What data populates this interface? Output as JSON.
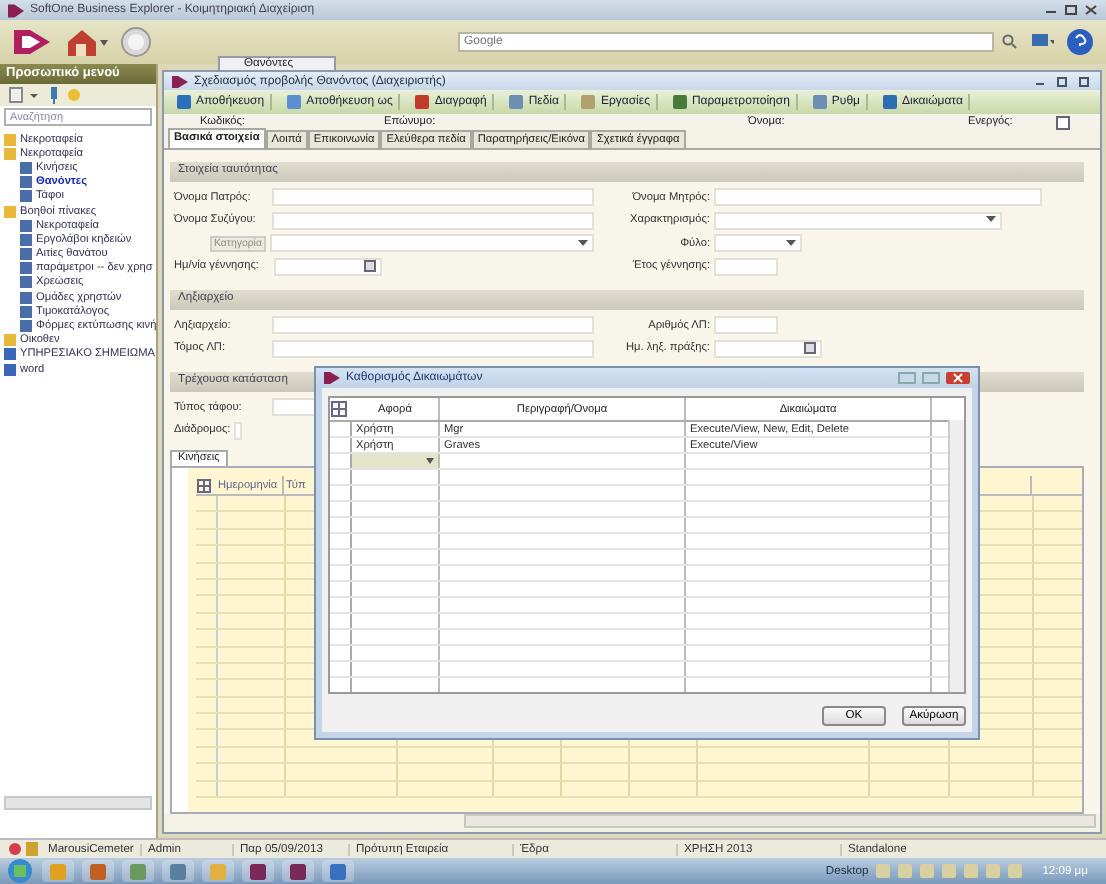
{
  "window": {
    "title": "SoftOne Business Explorer - Κοιμητηριακή Διαχείριση"
  },
  "toolbar": {
    "search": {
      "placeholder": "Google"
    }
  },
  "sidebar": {
    "title": "Προσωπικό μενού",
    "search": {
      "placeholder": "Αναζήτηση"
    },
    "tree": [
      {
        "label": "Νεκροταφεία",
        "kind": "folder",
        "selected": false
      },
      {
        "label": "Νεκροταφεία",
        "kind": "folder",
        "selected": false,
        "children": [
          {
            "label": "Κινήσεις",
            "kind": "form",
            "selected": false
          },
          {
            "label": "Θανόντες",
            "kind": "form",
            "selected": true
          },
          {
            "label": "Τάφοι",
            "kind": "form",
            "selected": false
          }
        ]
      },
      {
        "label": "Βοηθοί πίνακες",
        "kind": "folder",
        "selected": false,
        "children": [
          {
            "label": "Νεκροταφεία",
            "kind": "form",
            "selected": false
          },
          {
            "label": "Εργολάβοι κηδειών",
            "kind": "form",
            "selected": false
          },
          {
            "label": "Αιτίες θανάτου",
            "kind": "form",
            "selected": false
          },
          {
            "label": "παράμετροι -- δεν χρησ",
            "kind": "form",
            "selected": false
          },
          {
            "label": "Χρεώσεις",
            "kind": "form",
            "selected": false
          },
          {
            "label": "Ομάδες χρηστών",
            "kind": "form",
            "selected": false
          },
          {
            "label": "Τιμοκατάλογος",
            "kind": "form",
            "selected": false
          },
          {
            "label": "Φόρμες εκτύπωσης κινή",
            "kind": "form",
            "selected": false
          }
        ]
      },
      {
        "label": "Οικοθεν",
        "kind": "folder",
        "selected": false
      },
      {
        "label": "ΥΠΗΡΕΣΙΑΚΟ ΣΗΜΕΙΩΜΑ",
        "kind": "doc",
        "selected": false
      },
      {
        "label": "word",
        "kind": "doc",
        "selected": false
      }
    ]
  },
  "doc_tab": {
    "label": "Θανόντες"
  },
  "form": {
    "title": "Σχεδιασμός προβολής Θανόντος (Διαχειριστής)",
    "actions": [
      "Αποθήκευση",
      "Αποθήκευση ως",
      "Διαγραφή",
      "Πεδία",
      "Εργασίες",
      "Παραμετροποίηση",
      "Ρυθμ",
      "Δικαιώματα"
    ],
    "header_fields": [
      "Κωδικός:",
      "Επώνυμο:",
      "Όνομα:"
    ],
    "active": {
      "label": "Ενεργός:",
      "checked": false
    },
    "tabs": [
      {
        "label": "Βασικά στοιχεία",
        "selected": true
      },
      {
        "label": "Λοιπά",
        "selected": false
      },
      {
        "label": "Επικοινωνία",
        "selected": false
      },
      {
        "label": "Ελεύθερα πεδία",
        "selected": false
      },
      {
        "label": "Παρατηρήσεις/Εικόνα",
        "selected": false
      },
      {
        "label": "Σχετικά έγγραφα",
        "selected": false
      }
    ],
    "sections": [
      {
        "title": "Στοιχεία ταυτότητας",
        "rows": [
          [
            {
              "label": "Όνομα Πατρός:",
              "kind": "text"
            },
            {
              "label": "Όνομα Μητρός:",
              "kind": "text"
            }
          ],
          [
            {
              "label": "Όνομα Συζύγου:",
              "kind": "text"
            },
            {
              "label": "Χαρακτηρισμός:",
              "kind": "combo"
            }
          ],
          [
            {
              "label": "Κατηγορία",
              "kind": "lookup"
            },
            {
              "label": "Φύλο:",
              "kind": "small-combo"
            }
          ],
          [
            {
              "label": "Ημ/νία γέννησης:",
              "kind": "date"
            },
            {
              "label": "Έτος γέννησης:",
              "kind": "short"
            }
          ]
        ]
      },
      {
        "title": "Ληξιαρχείο",
        "rows": [
          [
            {
              "label": "Ληξιαρχείο:",
              "kind": "text"
            },
            {
              "label": "Αριθμός ΛΠ:",
              "kind": "short"
            }
          ],
          [
            {
              "label": "Τόμος ΛΠ:",
              "kind": "text"
            },
            {
              "label": "Ημ. ληξ. πράξης:",
              "kind": "date"
            }
          ]
        ]
      },
      {
        "title": "Τρέχουσα κατάσταση",
        "rows": [
          [
            {
              "label": "Τύπος τάφου:",
              "kind": "text"
            }
          ],
          [
            {
              "label": "Διάδρομος:",
              "kind": "search"
            }
          ]
        ]
      }
    ],
    "movements_tab": {
      "label": "Κινήσεις"
    },
    "grid": {
      "columns": [
        "Ημερομηνία",
        "Τύπ"
      ]
    }
  },
  "dialog": {
    "title": "Καθορισμός Δικαιωμάτων",
    "columns": [
      "Αφορά",
      "Περιγραφή/Όνομα",
      "Δικαιώματα"
    ],
    "rows": [
      [
        "Χρήστη",
        "Mgr",
        "Execute/View, New, Edit, Delete"
      ],
      [
        "Χρήστη",
        "Graves",
        "Execute/View"
      ]
    ],
    "buttons": [
      "OK",
      "Ακύρωση"
    ]
  },
  "status_bar": [
    "MarousiCemeter",
    "Admin",
    "Παρ 05/09/2013",
    "Πρότυπη Εταιρεία",
    "Έδρα",
    "ΧΡΗΣΗ 2013",
    "Standalone"
  ],
  "taskbar": {
    "desktop_label": "Desktop",
    "clock": "12:09 μμ"
  }
}
